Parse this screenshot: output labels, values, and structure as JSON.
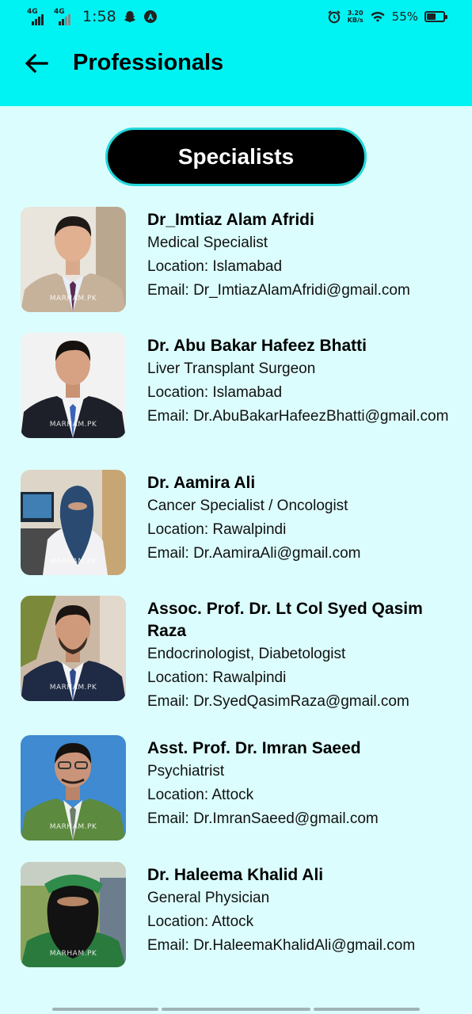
{
  "status_bar": {
    "network_1": "4G",
    "network_2": "4G",
    "time": "1:58",
    "speed_value": "3.20",
    "speed_unit": "KB/s",
    "battery_percent": "55%",
    "battery_level": 0.55,
    "icons": [
      "signal-icon",
      "snapchat-icon",
      "app-icon",
      "alarm-icon",
      "wifi-icon",
      "battery-icon"
    ]
  },
  "header": {
    "title": "Professionals",
    "back_icon": "arrow-left-icon",
    "background": "#00f3f3"
  },
  "tab_button": {
    "label": "Specialists"
  },
  "watermark": "MARHAM.PK",
  "doctors": [
    {
      "name": "Dr_Imtiaz Alam Afridi",
      "specialty": "Medical Specialist",
      "location": "Location: Islamabad",
      "email": "Email: Dr_ImtiazAlamAfridi@gmail.com"
    },
    {
      "name": "Dr. Abu Bakar Hafeez Bhatti",
      "specialty": "Liver Transplant Surgeon",
      "location": "Location: Islamabad",
      "email": "Email: Dr.AbuBakarHafeezBhatti@gmail.com"
    },
    {
      "name": "Dr. Aamira Ali",
      "specialty": "Cancer Specialist / Oncologist",
      "location": "Location: Rawalpindi",
      "email": "Email: Dr.AamiraAli@gmail.com"
    },
    {
      "name": "Assoc. Prof. Dr. Lt Col Syed Qasim Raza",
      "specialty": "Endocrinologist, Diabetologist",
      "location": "Location: Rawalpindi",
      "email": "Email: Dr.SyedQasimRaza@gmail.com"
    },
    {
      "name": "Asst. Prof. Dr. Imran Saeed",
      "specialty": "Psychiatrist",
      "location": "Location: Attock",
      "email": "Email: Dr.ImranSaeed@gmail.com"
    },
    {
      "name": "Dr. Haleema Khalid Ali",
      "specialty": "General Physician",
      "location": "Location: Attock",
      "email": "Email: Dr.HaleemaKhalidAli@gmail.com"
    }
  ]
}
